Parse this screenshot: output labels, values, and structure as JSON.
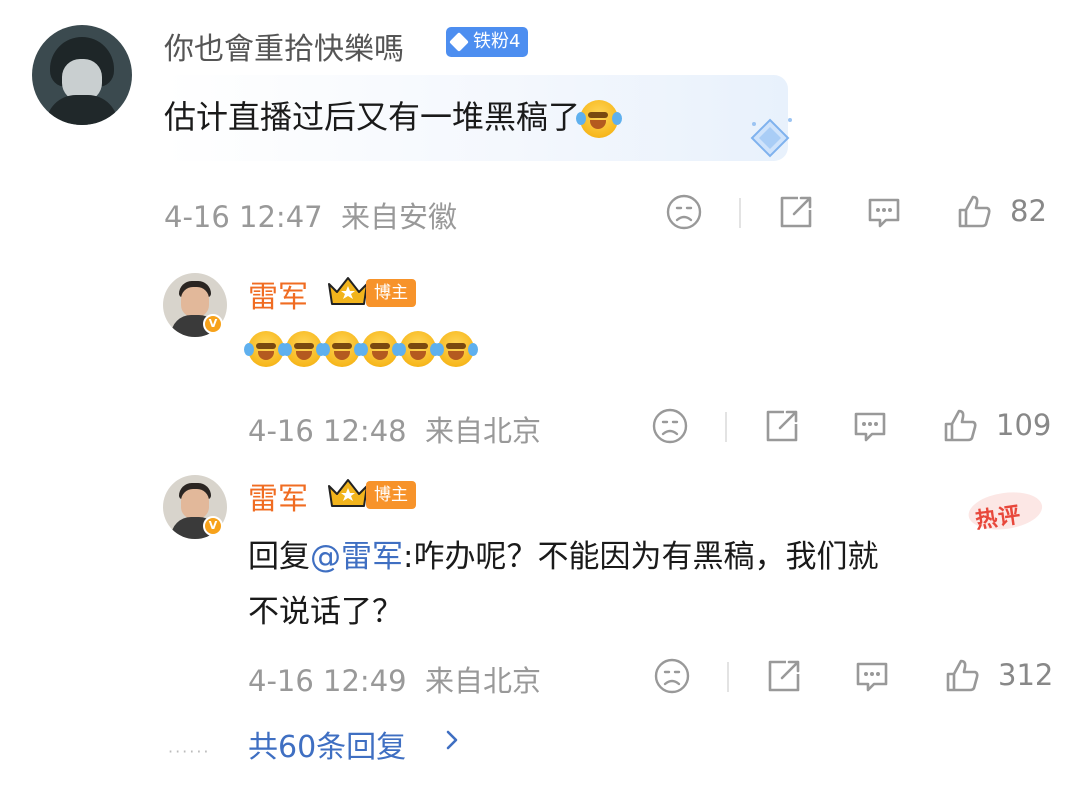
{
  "comment": {
    "username": "你也會重拾快樂嗎",
    "fan_badge": "铁粉4",
    "text": "估计直播过后又有一堆黑稿了",
    "timestamp": "4-16 12:47",
    "location": "来自安徽",
    "likes": "82"
  },
  "replies": [
    {
      "username": "雷军",
      "badge": "博主",
      "timestamp": "4-16 12:48",
      "location": "来自北京",
      "likes": "109"
    },
    {
      "username": "雷军",
      "badge": "博主",
      "reply_prefix": "回复",
      "mention": "@雷军",
      "text_line1": ":咋办呢？不能因为有黑稿，我们就",
      "text_line2": "不说话了？",
      "hot_label": "热评",
      "timestamp": "4-16 12:49",
      "location": "来自北京",
      "likes": "312"
    }
  ],
  "footer": {
    "dots": "······",
    "more_replies": "共60条回复"
  },
  "colors": {
    "username_default": "#555555",
    "blogger_name": "#f06c22",
    "mention": "#3f6fc2",
    "fan_badge_bg": "#4d8ef0",
    "blogger_badge_bg": "#f7932a",
    "meta_text": "#999999"
  },
  "icons": [
    "sad-face-icon",
    "share-icon",
    "comment-icon",
    "thumbs-up-icon",
    "crown-icon",
    "diamond-gem-icon",
    "chevron-right-icon",
    "verified-v-icon",
    "laughing-crying-emoji"
  ]
}
